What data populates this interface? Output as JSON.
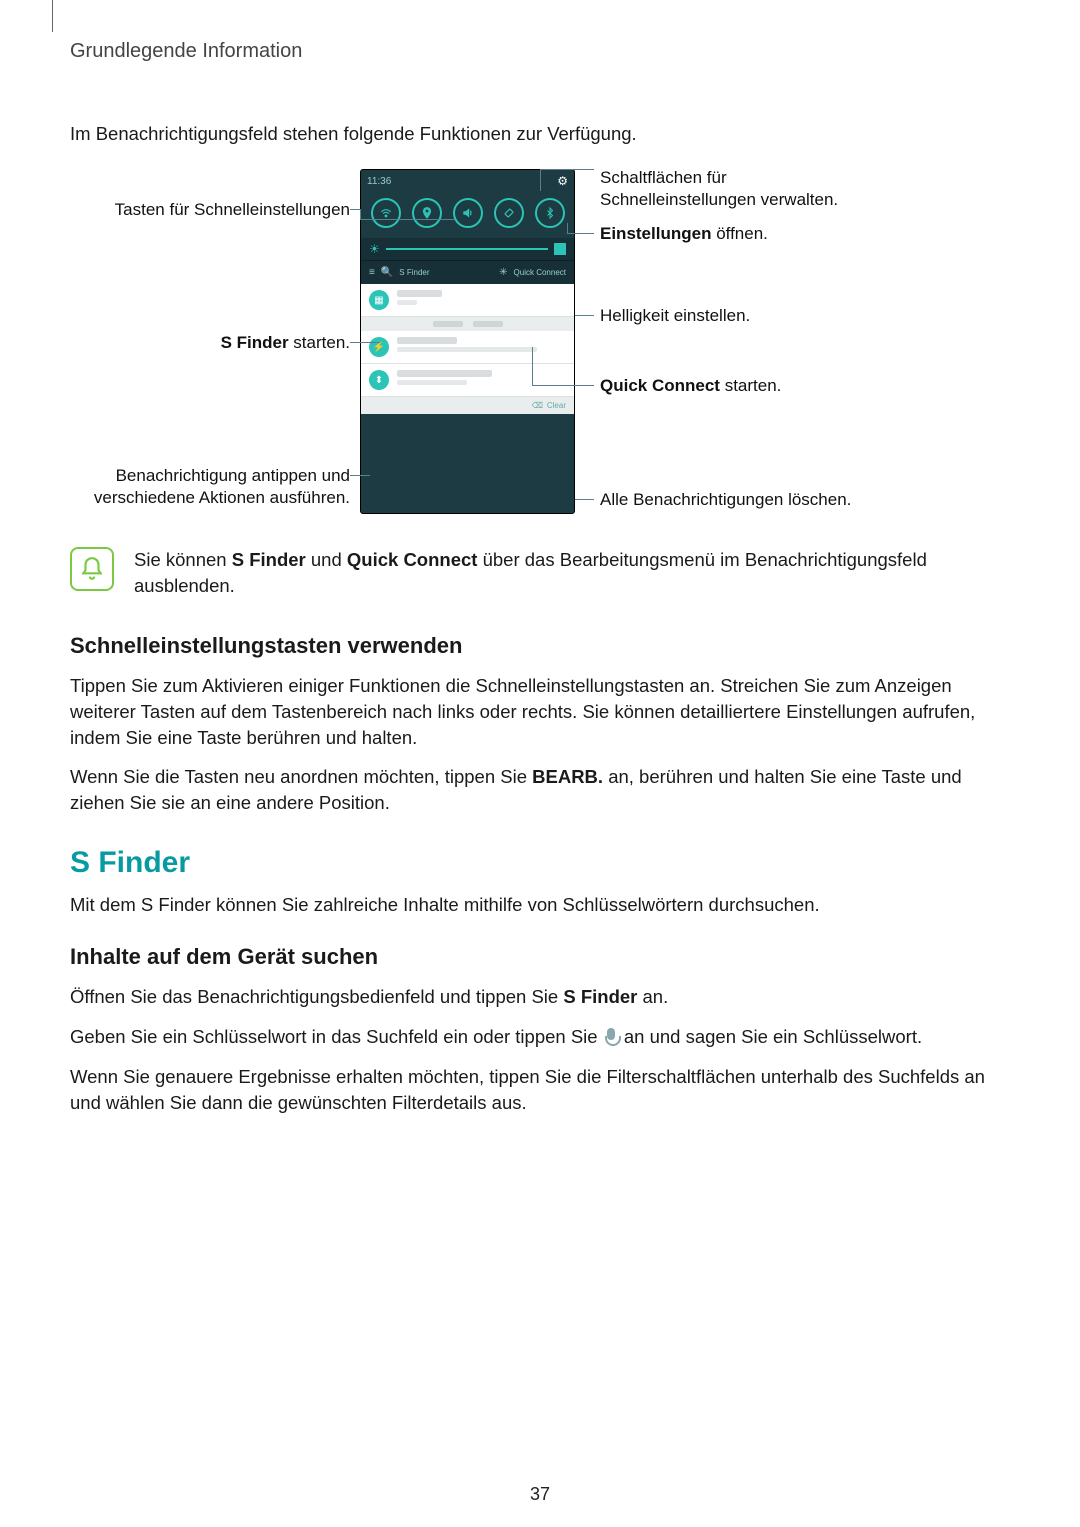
{
  "header": {
    "title": "Grundlegende Information"
  },
  "intro": "Im Benachrichtigungsfeld stehen folgende Funktionen zur Verfügung.",
  "callouts": {
    "left_quick_keys": "Tasten für Schnelleinstellungen",
    "left_sfinder_prefix": "S Finder",
    "left_sfinder_suffix": " starten.",
    "left_notif_line1": "Benachrichtigung antippen und",
    "left_notif_line2": "verschiedene Aktionen ausführen.",
    "right_manage_line1": "Schaltflächen für",
    "right_manage_line2": "Schnelleinstellungen verwalten.",
    "right_settings_prefix": "Einstellungen",
    "right_settings_suffix": " öffnen.",
    "right_brightness": "Helligkeit einstellen.",
    "right_quickconnect_prefix": "Quick Connect",
    "right_quickconnect_suffix": " starten.",
    "right_clear_all": "Alle Benachrichtigungen löschen."
  },
  "phone": {
    "time": "11:36",
    "quick_icons": [
      "wifi",
      "location",
      "sound",
      "rotate",
      "bluetooth"
    ],
    "finder_left": "S Finder",
    "finder_right": "Quick Connect",
    "clear_label": "Clear"
  },
  "tip": {
    "text_prefix": "Sie können ",
    "bold1": "S Finder",
    "mid1": " und ",
    "bold2": "Quick Connect",
    "text_suffix": " über das Bearbeitungsmenü im Benachrichtigungsfeld ausblenden."
  },
  "sec1": {
    "heading": "Schnelleinstellungstasten verwenden",
    "p1": "Tippen Sie zum Aktivieren einiger Funktionen die Schnelleinstellungstasten an. Streichen Sie zum Anzeigen weiterer Tasten auf dem Tastenbereich nach links oder rechts. Sie können detailliertere Einstellungen aufrufen, indem Sie eine Taste berühren und halten.",
    "p2_prefix": "Wenn Sie die Tasten neu anordnen möchten, tippen Sie ",
    "p2_bold": "BEARB.",
    "p2_suffix": " an, berühren und halten Sie eine Taste und ziehen Sie sie an eine andere Position."
  },
  "sec2": {
    "heading": "S Finder",
    "p1": "Mit dem S Finder können Sie zahlreiche Inhalte mithilfe von Schlüsselwörtern durchsuchen.",
    "subheading": "Inhalte auf dem Gerät suchen",
    "p2_prefix": "Öffnen Sie das Benachrichtigungsbedienfeld und tippen Sie ",
    "p2_bold": "S Finder",
    "p2_suffix": " an.",
    "p3_prefix": "Geben Sie ein Schlüsselwort in das Suchfeld ein oder tippen Sie ",
    "p3_suffix": " an und sagen Sie ein Schlüsselwort.",
    "p4": "Wenn Sie genauere Ergebnisse erhalten möchten, tippen Sie die Filterschaltflächen unterhalb des Suchfelds an und wählen Sie dann die gewünschten Filterdetails aus."
  },
  "page_number": "37"
}
